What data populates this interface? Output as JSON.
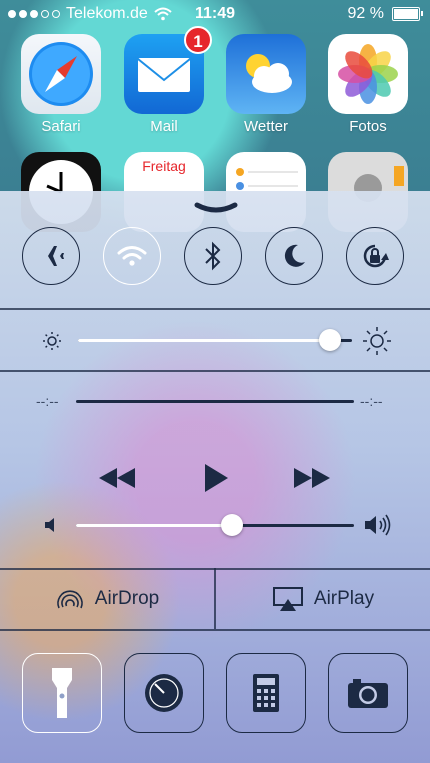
{
  "status_bar": {
    "carrier": "Telekom.de",
    "time": "11:49",
    "battery": "92 %"
  },
  "home_apps": [
    {
      "label": "Safari",
      "icon": "safari-icon"
    },
    {
      "label": "Mail",
      "icon": "mail-icon",
      "badge": "1"
    },
    {
      "label": "Wetter",
      "icon": "weather-icon"
    },
    {
      "label": "Fotos",
      "icon": "photos-icon"
    },
    {
      "label": "",
      "icon": "clock-icon"
    },
    {
      "label": "",
      "icon": "calendar-icon",
      "day": "Freitag"
    },
    {
      "label": "",
      "icon": "reminders-icon"
    },
    {
      "label": "",
      "icon": "contacts-icon"
    }
  ],
  "control_center": {
    "toggles": [
      {
        "name": "airplane-mode",
        "on": false
      },
      {
        "name": "wifi",
        "on": true
      },
      {
        "name": "bluetooth",
        "on": false
      },
      {
        "name": "do-not-disturb",
        "on": false
      },
      {
        "name": "rotation-lock",
        "on": false
      }
    ],
    "brightness_level": 0.92,
    "media": {
      "elapsed": "--:--",
      "remaining": "--:--"
    },
    "volume_level": 0.56,
    "airdrop_label": "AirDrop",
    "airplay_label": "AirPlay",
    "quick_apps": [
      {
        "name": "flashlight",
        "on": true
      },
      {
        "name": "timer",
        "on": false
      },
      {
        "name": "calculator",
        "on": false
      },
      {
        "name": "camera",
        "on": false
      }
    ]
  },
  "colors": {
    "panel_ink": "#1c2a44",
    "badge_red": "#e6262b",
    "active_white": "#ffffff"
  }
}
